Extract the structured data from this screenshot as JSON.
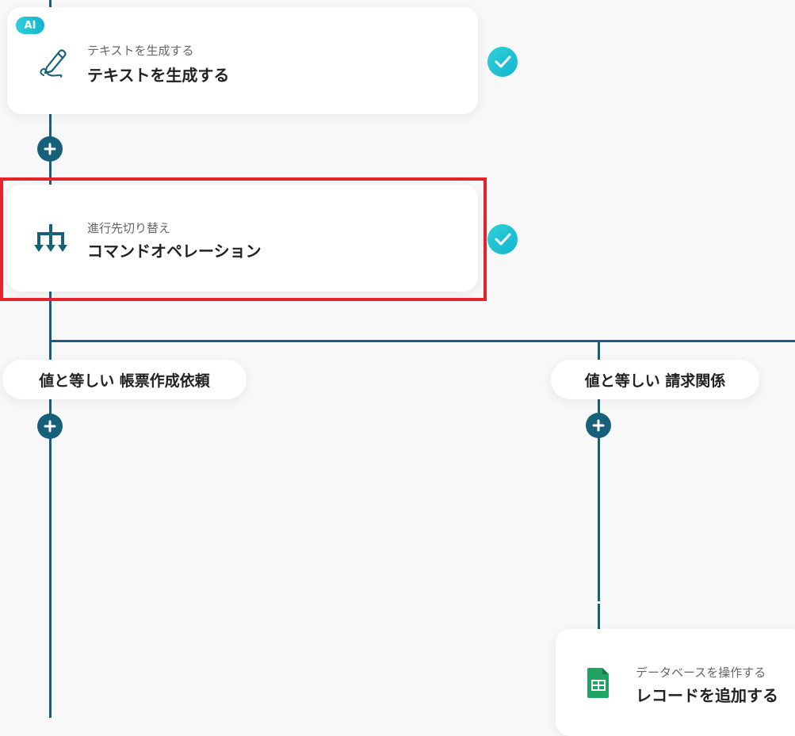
{
  "ai_badge": "AI",
  "steps": {
    "text_gen": {
      "sub": "テキストを生成する",
      "title": "テキストを生成する"
    },
    "switch": {
      "sub": "進行先切り替え",
      "title": "コマンドオペレーション"
    },
    "db": {
      "sub": "データベースを操作する",
      "title": "レコードを追加する"
    }
  },
  "branches": {
    "left": "値と等しい 帳票作成依頼",
    "right": "値と等しい 請求関係"
  },
  "icons": {
    "text_gen": "pen-icon",
    "switch": "branch-icon",
    "db": "spreadsheet-icon",
    "check": "check-icon",
    "add": "plus-icon"
  },
  "colors": {
    "line": "#17607a",
    "accent": "#14b4cf",
    "highlight": "#e4232b",
    "sheets_green": "#1fa463"
  }
}
